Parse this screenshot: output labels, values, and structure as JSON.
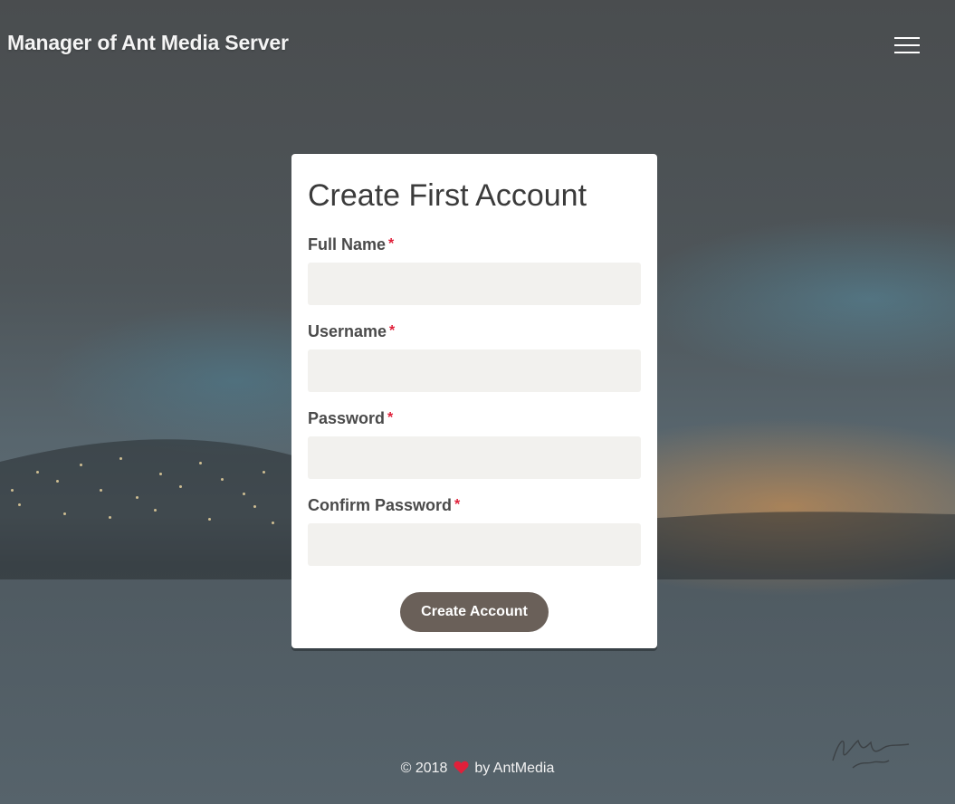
{
  "header": {
    "brand": "Manager of Ant Media Server",
    "menu_icon": "hamburger-icon"
  },
  "form": {
    "title": "Create First Account",
    "required_mark": "*",
    "fields": [
      {
        "label": "Full Name",
        "value": "",
        "placeholder": ""
      },
      {
        "label": "Username",
        "value": "",
        "placeholder": ""
      },
      {
        "label": "Password",
        "value": "",
        "placeholder": ""
      },
      {
        "label": "Confirm Password",
        "value": "",
        "placeholder": ""
      }
    ],
    "submit_label": "Create Account"
  },
  "footer": {
    "copyright": "© 2018",
    "heart_icon": "heart-icon",
    "by_text": "by AntMedia"
  },
  "colors": {
    "required": "#e0203a",
    "button": "#6a6059",
    "input_bg": "#f2f1ee",
    "heart": "#e0203a"
  }
}
